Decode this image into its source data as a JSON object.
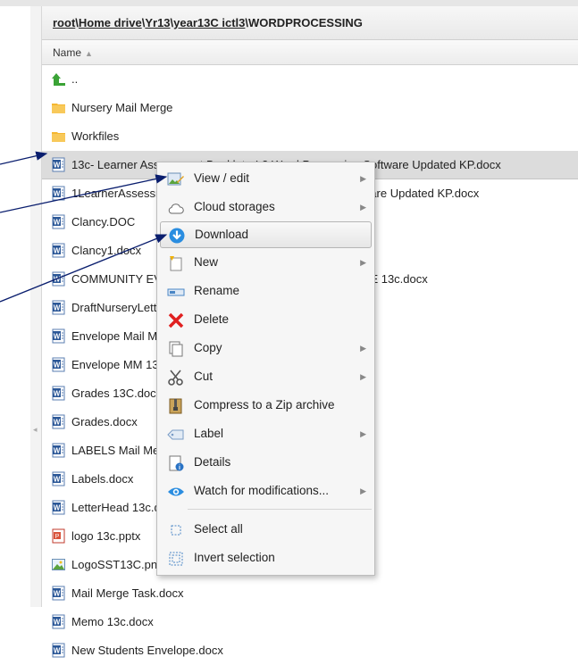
{
  "breadcrumb": {
    "parts": [
      "root",
      "Home drive",
      "Yr13",
      "year13C ictl3",
      "WORDPROCESSING"
    ],
    "separator": "\\"
  },
  "column_header": {
    "name_label": "Name",
    "sort_indicator": "▲"
  },
  "files": [
    {
      "name": "..",
      "type": "up"
    },
    {
      "name": "Nursery Mail Merge",
      "type": "folder"
    },
    {
      "name": "Workfiles",
      "type": "folder"
    },
    {
      "name": "13c- Learner Assessment Booklet - L3 Word Processing Software Updated KP.docx",
      "type": "word",
      "selected": true
    },
    {
      "name": "1LearnerAssessment Booklet - L3 Word Processing Software Updated KP.docx",
      "type": "word"
    },
    {
      "name": "Clancy.DOC",
      "type": "word"
    },
    {
      "name": "Clancy1.docx",
      "type": "word"
    },
    {
      "name": "COMMUNITY EVENTS LETTER MAIL MERGE EXERCISE 13c.docx",
      "type": "word"
    },
    {
      "name": "DraftNurseryLetter.docx",
      "type": "word"
    },
    {
      "name": "Envelope Mail Merge.docx",
      "type": "word"
    },
    {
      "name": "Envelope MM 13c.docx",
      "type": "word"
    },
    {
      "name": "Grades 13C.docx",
      "type": "word"
    },
    {
      "name": "Grades.docx",
      "type": "word"
    },
    {
      "name": "LABELS Mail Merge.docx",
      "type": "word"
    },
    {
      "name": "Labels.docx",
      "type": "word"
    },
    {
      "name": "LetterHead 13c.docx",
      "type": "word"
    },
    {
      "name": "logo 13c.pptx",
      "type": "ppt"
    },
    {
      "name": "LogoSST13C.png",
      "type": "image"
    },
    {
      "name": "Mail Merge Task.docx",
      "type": "word"
    },
    {
      "name": "Memo 13c.docx",
      "type": "word"
    },
    {
      "name": "New Students Envelope.docx",
      "type": "word"
    }
  ],
  "context_menu": {
    "items": [
      {
        "label": "View / edit",
        "icon": "view-edit-icon",
        "submenu": true
      },
      {
        "label": "Cloud storages",
        "icon": "cloud-icon",
        "submenu": true
      },
      {
        "label": "Download",
        "icon": "download-icon",
        "submenu": false,
        "highlighted": true
      },
      {
        "label": "New",
        "icon": "new-icon",
        "submenu": true
      },
      {
        "label": "Rename",
        "icon": "rename-icon",
        "submenu": false
      },
      {
        "label": "Delete",
        "icon": "delete-icon",
        "submenu": false
      },
      {
        "label": "Copy",
        "icon": "copy-icon",
        "submenu": true
      },
      {
        "label": "Cut",
        "icon": "scissors-icon",
        "submenu": true
      },
      {
        "label": "Compress to a Zip archive",
        "icon": "zip-icon",
        "submenu": false
      },
      {
        "label": "Label",
        "icon": "label-icon",
        "submenu": true
      },
      {
        "label": "Details",
        "icon": "details-icon",
        "submenu": false
      },
      {
        "label": "Watch for modifications...",
        "icon": "eye-icon",
        "submenu": true
      },
      {
        "label": "Select all",
        "icon": "select-all-icon",
        "submenu": false
      },
      {
        "label": "Invert selection",
        "icon": "invert-selection-icon",
        "submenu": false
      }
    ]
  },
  "colors": {
    "selected_row": "#dcdcdc",
    "folder": "#f5b731",
    "word_icon": "#2b5797",
    "arrow": "#0a1e6e",
    "download_icon": "#2a8de0",
    "delete_icon": "#e02020",
    "up_arrow": "#3aa336"
  }
}
